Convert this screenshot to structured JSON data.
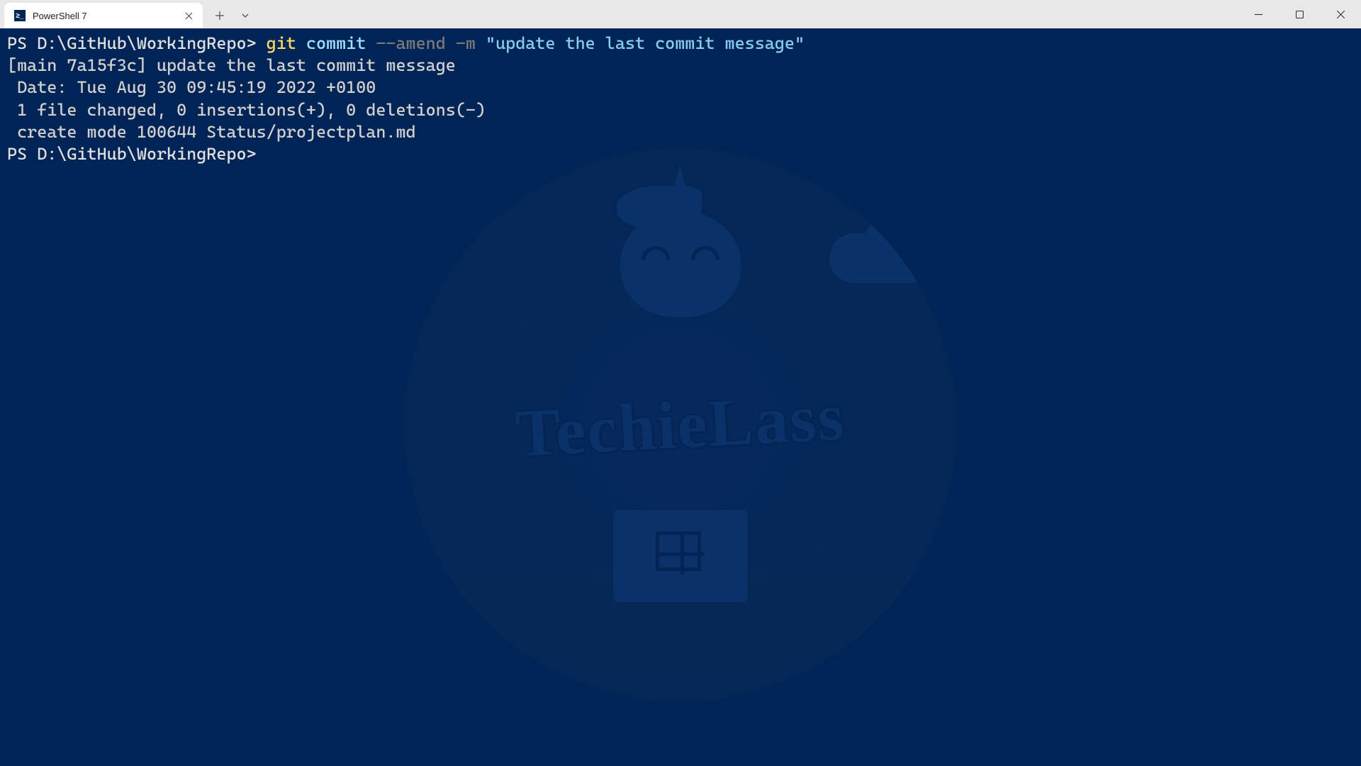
{
  "tab": {
    "title": "PowerShell 7",
    "icon_label": "powershell-icon"
  },
  "terminal": {
    "prompt1": "PS D:\\GitHub\\WorkingRepo> ",
    "cmd_git": "git",
    "cmd_commit": " commit ",
    "cmd_amend": "--amend",
    "cmd_m": " -m ",
    "cmd_msg": "\"update the last commit message\"",
    "out_line1": "[main 7a15f3c] update the last commit message",
    "out_line2": " Date: Tue Aug 30 09:45:19 2022 +0100",
    "out_line3": " 1 file changed, 0 insertions(+), 0 deletions(-)",
    "out_line4": " create mode 100644 Status/projectplan.md",
    "prompt2": "PS D:\\GitHub\\WorkingRepo> "
  },
  "watermark_text": "TechieLass"
}
